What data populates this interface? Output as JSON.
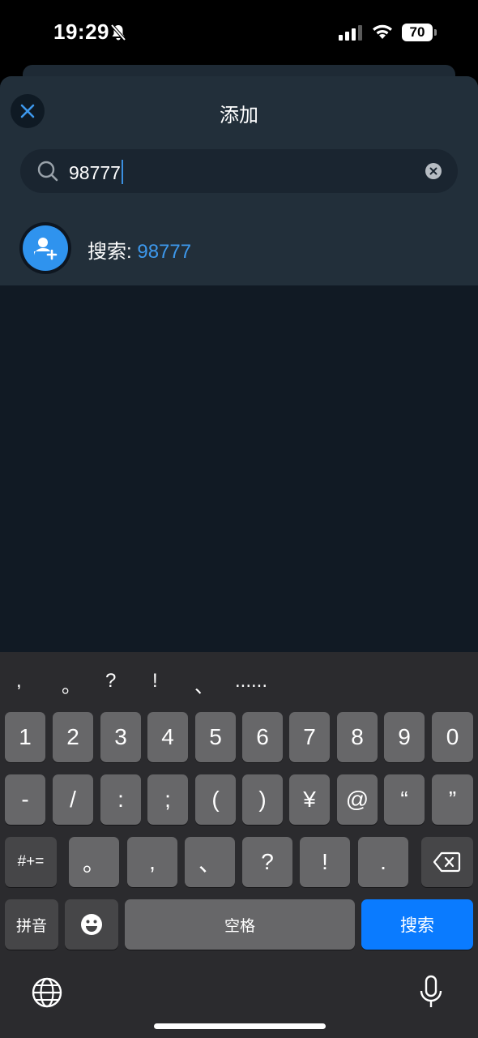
{
  "status": {
    "time": "19:29",
    "battery": "70"
  },
  "sheet": {
    "title": "添加"
  },
  "search": {
    "value": "98777"
  },
  "result": {
    "prefix": "搜索: ",
    "query": "98777"
  },
  "keyboard": {
    "candidates": [
      ",",
      "。",
      "?",
      "!",
      "、",
      "......"
    ],
    "row1": [
      "1",
      "2",
      "3",
      "4",
      "5",
      "6",
      "7",
      "8",
      "9",
      "0"
    ],
    "row2": [
      "-",
      "/",
      ":",
      ";",
      "(",
      ")",
      "¥",
      "@",
      "“",
      "”"
    ],
    "row3_mode": "#+=",
    "row3": [
      "。",
      ",",
      "、",
      "?",
      "!",
      "."
    ],
    "pinyin": "拼音",
    "space": "空格",
    "search": "搜索"
  },
  "colors": {
    "accent": "#2f93ee",
    "sheet_bg": "#111a24",
    "header_bg": "#222f3a",
    "key_blue": "#0a7bff"
  },
  "icons": [
    "bell-off-icon",
    "signal-icon",
    "wifi-icon",
    "close-icon",
    "search-icon",
    "clear-icon",
    "add-user-icon",
    "backspace-icon",
    "emoji-icon",
    "globe-icon",
    "mic-icon"
  ]
}
